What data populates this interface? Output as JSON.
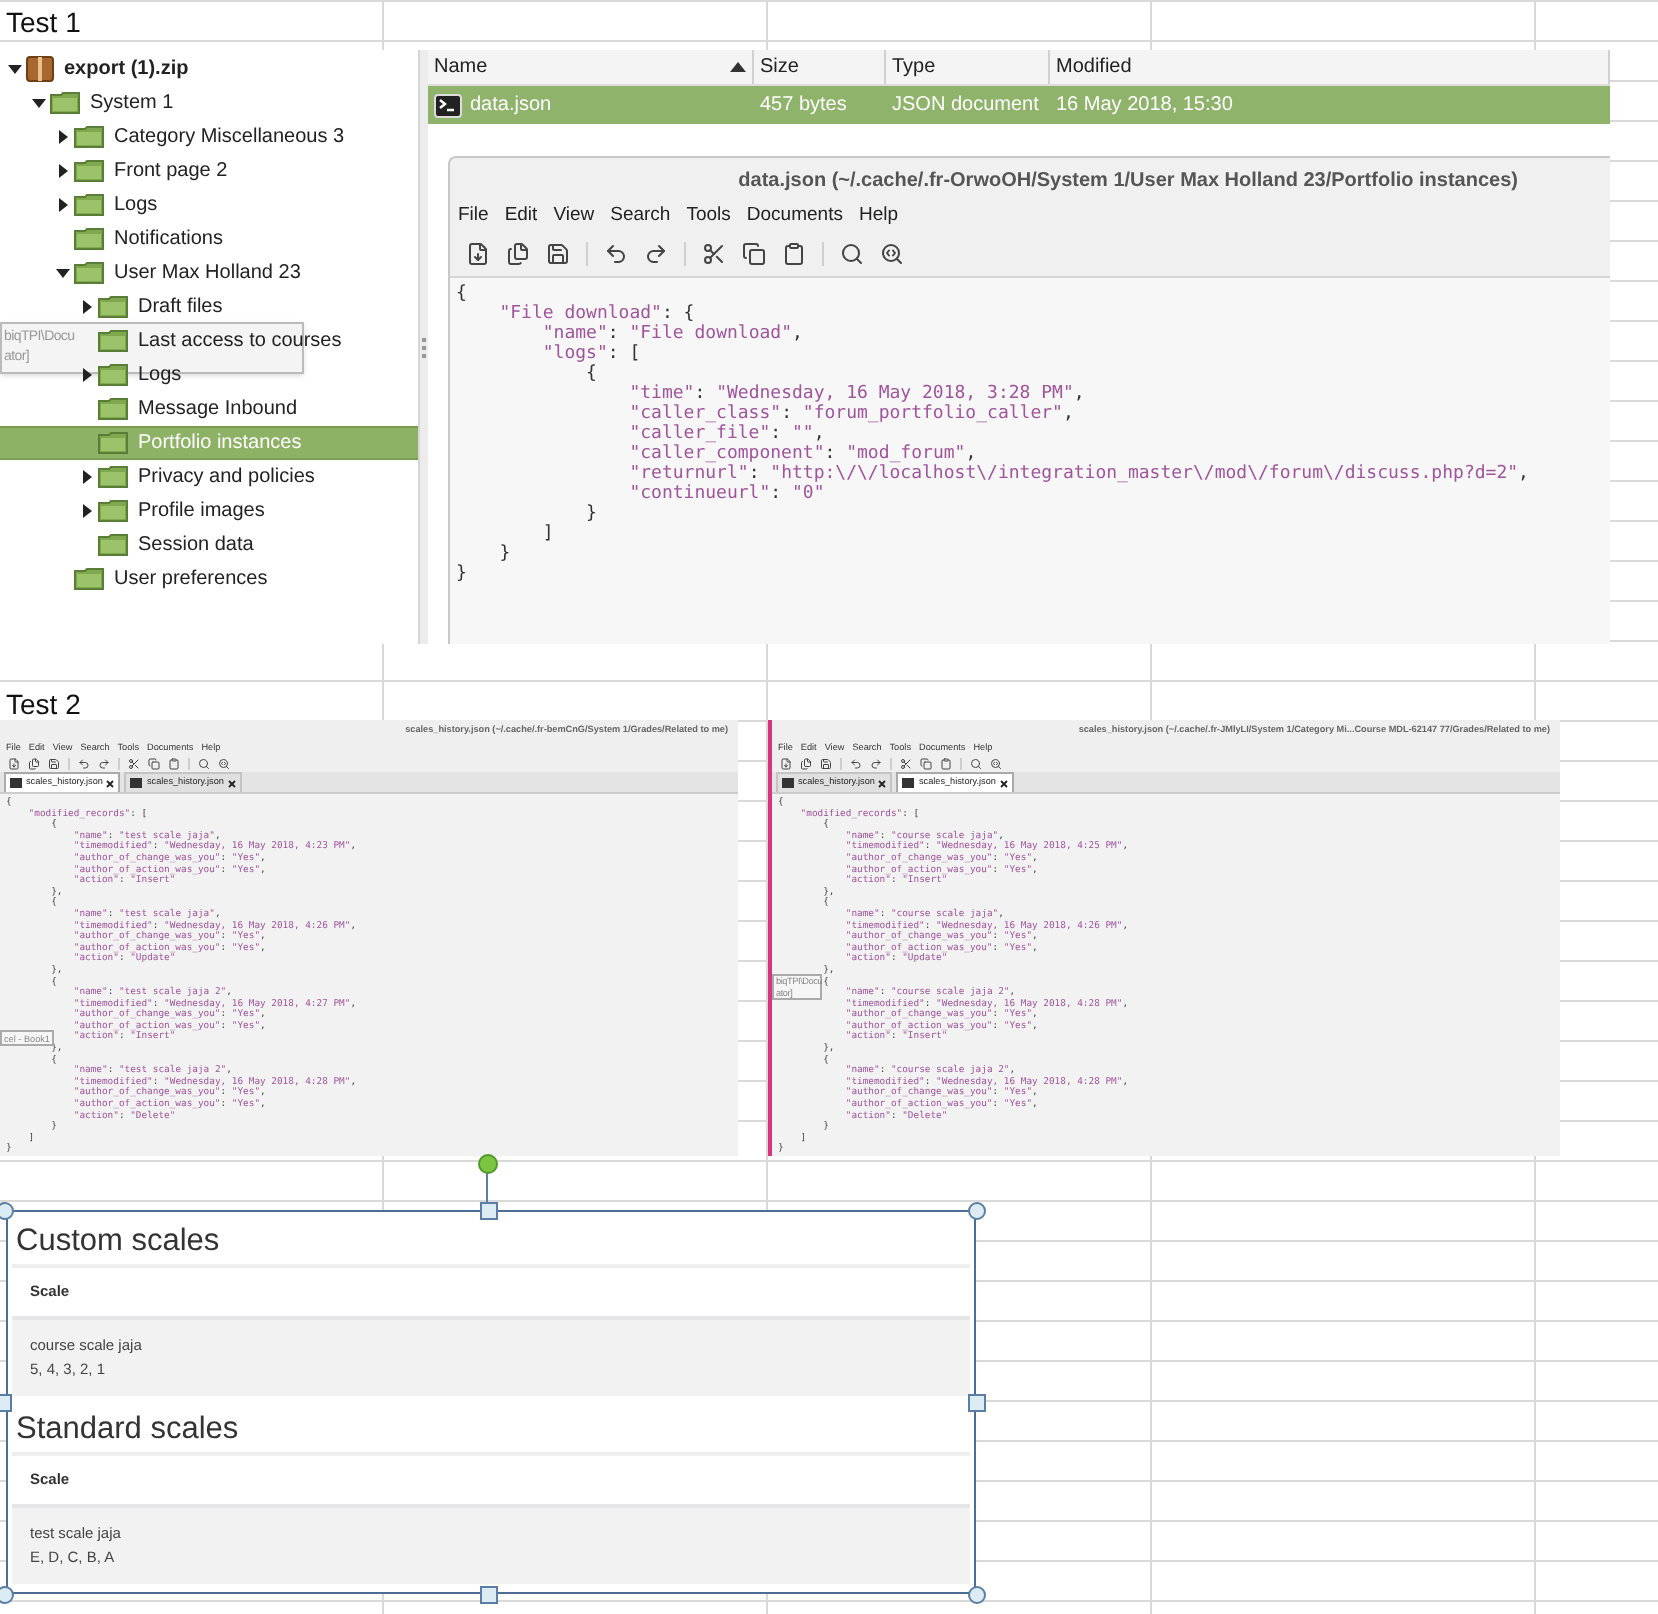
{
  "test1": {
    "label": "Test 1",
    "tree": [
      {
        "label": "export (1).zip",
        "kind": "archive",
        "expanded": true,
        "selected": false,
        "children": [
          {
            "label": "System 1",
            "kind": "folder",
            "expanded": true,
            "selected": false,
            "children": [
              {
                "label": "Category Miscellaneous 3",
                "kind": "folder",
                "expanded": false,
                "selected": false
              },
              {
                "label": "Front page 2",
                "kind": "folder",
                "expanded": false,
                "selected": false
              },
              {
                "label": "Logs",
                "kind": "folder",
                "expanded": false,
                "selected": false
              },
              {
                "label": "Notifications",
                "kind": "folder",
                "selected": false
              },
              {
                "label": "User Max Holland 23",
                "kind": "folder",
                "expanded": true,
                "selected": false,
                "children": [
                  {
                    "label": "Draft files",
                    "kind": "folder",
                    "expanded": false,
                    "selected": false
                  },
                  {
                    "label": "Last access to courses",
                    "kind": "folder",
                    "selected": false
                  },
                  {
                    "label": "Logs",
                    "kind": "folder",
                    "expanded": false,
                    "selected": false
                  },
                  {
                    "label": "Message Inbound",
                    "kind": "folder",
                    "selected": false
                  },
                  {
                    "label": "Portfolio instances",
                    "kind": "folder",
                    "selected": true
                  },
                  {
                    "label": "Privacy and policies",
                    "kind": "folder",
                    "expanded": false,
                    "selected": false
                  },
                  {
                    "label": "Profile images",
                    "kind": "folder",
                    "expanded": false,
                    "selected": false
                  },
                  {
                    "label": "Session data",
                    "kind": "folder",
                    "selected": false
                  }
                ]
              },
              {
                "label": "User preferences",
                "kind": "folder",
                "selected": false
              }
            ]
          }
        ]
      }
    ],
    "tooltip": {
      "lines": [
        "biqTPI\\Docu",
        "ator]"
      ]
    },
    "file_list": {
      "columns": [
        {
          "label": "Name",
          "sorted": true
        },
        {
          "label": "Size"
        },
        {
          "label": "Type"
        },
        {
          "label": "Modified"
        }
      ],
      "rows": [
        {
          "cells": [
            "data.json",
            "457 bytes",
            "JSON document",
            "16 May 2018, 15:30"
          ],
          "selected": true
        }
      ]
    },
    "editor": {
      "title": "data.json (~/.cache/.fr-OrwoOH/System 1/User Max Holland 23/Portfolio instances)",
      "menu": [
        "File",
        "Edit",
        "View",
        "Search",
        "Tools",
        "Documents",
        "Help"
      ],
      "lines": [
        "{",
        "    \"File download\": {",
        "        \"name\": \"File download\",",
        "        \"logs\": [",
        "            {",
        "                \"time\": \"Wednesday, 16 May 2018, 3:28 PM\",",
        "                \"caller_class\": \"forum_portfolio_caller\",",
        "                \"caller_file\": \"\",",
        "                \"caller_component\": \"mod_forum\",",
        "                \"returnurl\": \"http:\\/\\/localhost\\/integration_master\\/mod\\/forum\\/discuss.php?d=2\",",
        "                \"continueurl\": \"0\"",
        "            }",
        "        ]",
        "    }",
        "}"
      ]
    }
  },
  "test2": {
    "label": "Test 2",
    "editors": [
      {
        "title": "scales_history.json (~/.cache/.fr-bemCnG/System 1/Grades/Related to me)",
        "menu": [
          "File",
          "Edit",
          "View",
          "Search",
          "Tools",
          "Documents",
          "Help"
        ],
        "tabs": [
          {
            "label": "scales_history.json",
            "selected": true
          },
          {
            "label": "scales_history.json",
            "selected": false
          }
        ],
        "tooltip": {
          "lines": [
            "cel - Book1"
          ]
        },
        "lines": [
          "{",
          "    \"modified_records\": [",
          "        {",
          "            \"name\": \"test scale jaja\",",
          "            \"timemodified\": \"Wednesday, 16 May 2018, 4:23 PM\",",
          "            \"author_of_change_was_you\": \"Yes\",",
          "            \"author_of_action_was_you\": \"Yes\",",
          "            \"action\": \"Insert\"",
          "        },",
          "        {",
          "            \"name\": \"test scale jaja\",",
          "            \"timemodified\": \"Wednesday, 16 May 2018, 4:26 PM\",",
          "            \"author_of_change_was_you\": \"Yes\",",
          "            \"author_of_action_was_you\": \"Yes\",",
          "            \"action\": \"Update\"",
          "        },",
          "        {",
          "            \"name\": \"test scale jaja 2\",",
          "            \"timemodified\": \"Wednesday, 16 May 2018, 4:27 PM\",",
          "            \"author_of_change_was_you\": \"Yes\",",
          "            \"author_of_action_was_you\": \"Yes\",",
          "            \"action\": \"Insert\"",
          "        },",
          "        {",
          "            \"name\": \"test scale jaja 2\",",
          "            \"timemodified\": \"Wednesday, 16 May 2018, 4:28 PM\",",
          "            \"author_of_change_was_you\": \"Yes\",",
          "            \"author_of_action_was_you\": \"Yes\",",
          "            \"action\": \"Delete\"",
          "        }",
          "    ]",
          "}"
        ]
      },
      {
        "title": "scales_history.json (~/.cache/.fr-JMlyLI/System 1/Category Mi...Course MDL-62147 77/Grades/Related to me)",
        "menu": [
          "File",
          "Edit",
          "View",
          "Search",
          "Tools",
          "Documents",
          "Help"
        ],
        "tabs": [
          {
            "label": "scales_history.json",
            "selected": false
          },
          {
            "label": "scales_history.json",
            "selected": true
          }
        ],
        "tooltip": {
          "lines": [
            "biqTPI\\Docu",
            "ator]"
          ]
        },
        "lines": [
          "{",
          "    \"modified_records\": [",
          "        {",
          "            \"name\": \"course scale jaja\",",
          "            \"timemodified\": \"Wednesday, 16 May 2018, 4:25 PM\",",
          "            \"author_of_change_was_you\": \"Yes\",",
          "            \"author_of_action_was_you\": \"Yes\",",
          "            \"action\": \"Insert\"",
          "        },",
          "        {",
          "            \"name\": \"course scale jaja\",",
          "            \"timemodified\": \"Wednesday, 16 May 2018, 4:26 PM\",",
          "            \"author_of_change_was_you\": \"Yes\",",
          "            \"author_of_action_was_you\": \"Yes\",",
          "            \"action\": \"Update\"",
          "        },",
          "        {",
          "            \"name\": \"course scale jaja 2\",",
          "            \"timemodified\": \"Wednesday, 16 May 2018, 4:28 PM\",",
          "            \"author_of_change_was_you\": \"Yes\",",
          "            \"author_of_action_was_you\": \"Yes\",",
          "            \"action\": \"Insert\"",
          "        },",
          "        {",
          "            \"name\": \"course scale jaja 2\",",
          "            \"timemodified\": \"Wednesday, 16 May 2018, 4:28 PM\",",
          "            \"author_of_change_was_you\": \"Yes\",",
          "            \"author_of_action_was_you\": \"Yes\",",
          "            \"action\": \"Delete\"",
          "        }",
          "    ]",
          "}"
        ]
      }
    ]
  },
  "scales_panel": {
    "sections": [
      {
        "heading": "Custom scales",
        "column": "Scale",
        "rows": [
          {
            "name": "course scale jaja",
            "values": "5, 4, 3, 2, 1"
          }
        ]
      },
      {
        "heading": "Standard scales",
        "column": "Scale",
        "rows": [
          {
            "name": "test scale jaja",
            "values": "E, D, C, B, A"
          }
        ]
      }
    ]
  }
}
